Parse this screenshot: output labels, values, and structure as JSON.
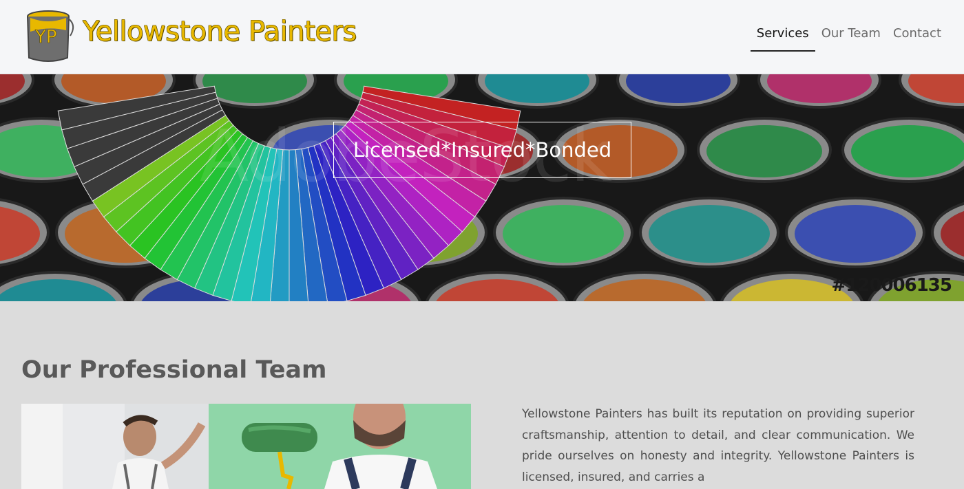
{
  "header": {
    "logo_monogram": "YP",
    "brand_name": "Yellowstone Painters",
    "nav": [
      {
        "label": "Services",
        "active": true
      },
      {
        "label": "Our Team",
        "active": false
      },
      {
        "label": "Contact",
        "active": false
      }
    ]
  },
  "hero": {
    "tagline": "Licensed*Insured*Bonded",
    "watermark_brand": "AdobeStock",
    "watermark_id": "#120006135"
  },
  "team": {
    "title": "Our Professional Team",
    "description": "Yellowstone Painters has built its reputation on providing superior craftsmanship, attention to detail, and clear communication. We pride ourselves on honesty and integrity. Yellowstone Painters is licensed, insured, and carries a"
  },
  "colors": {
    "brand_yellow": "#e8b800",
    "header_bg": "#f5f6f8",
    "page_bg": "#dcdcdc",
    "nav_active": "#111111",
    "nav_inactive": "#6a6a6a"
  }
}
